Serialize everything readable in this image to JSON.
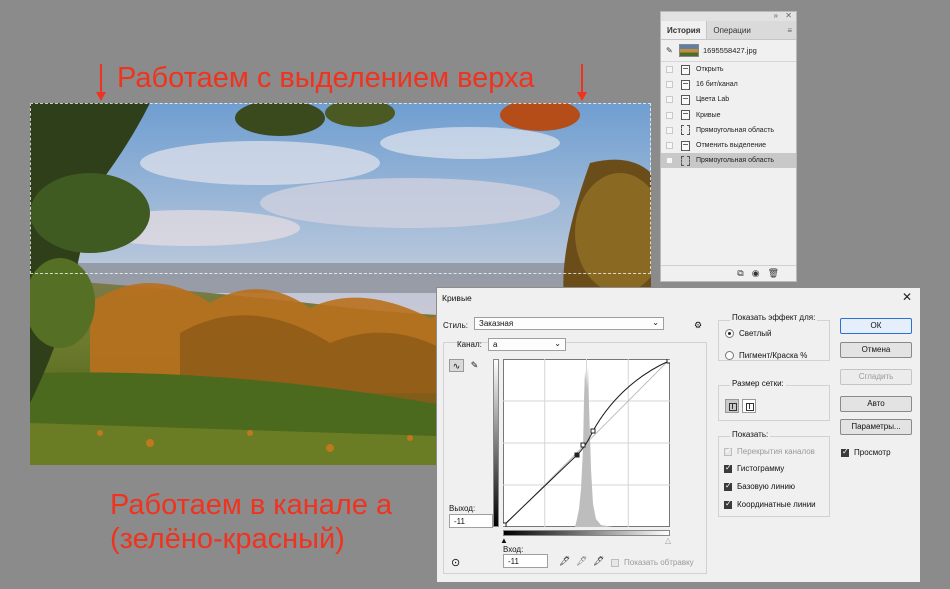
{
  "annotations": {
    "top": "Работаем с выделением верха",
    "bottom_line1": "Работаем в канале а",
    "bottom_line2": "(зелёно-красный)"
  },
  "history_panel": {
    "tabs": [
      "История",
      "Операции"
    ],
    "menu_icon": "menu-icon",
    "collapse_icon": "collapse-icon",
    "close_icon": "close-icon",
    "snapshot": "1695558427.jpg",
    "steps": [
      {
        "label": "Открыть",
        "icon": "document-icon"
      },
      {
        "label": "16 бит/канал",
        "icon": "document-icon"
      },
      {
        "label": "Цвета Lab",
        "icon": "document-icon"
      },
      {
        "label": "Кривые",
        "icon": "document-icon"
      },
      {
        "label": "Прямоугольная область",
        "icon": "marquee-icon"
      },
      {
        "label": "Отменить выделение",
        "icon": "document-icon"
      },
      {
        "label": "Прямоугольная область",
        "icon": "marquee-icon",
        "active": true
      }
    ],
    "footer_icons": [
      "new-document-from-state-icon",
      "camera-icon",
      "trash-icon"
    ]
  },
  "curves_dialog": {
    "title": "Кривые",
    "close": "✕",
    "style_label": "Стиль:",
    "style_value": "Заказная",
    "channel_label": "Канал:",
    "channel_value": "a",
    "output_label": "Выход:",
    "output_value": "-11",
    "input_label": "Вход:",
    "input_value": "-11",
    "show_clipping": "Показать обтравку",
    "show_effect_label": "Показать эффект для:",
    "radio_light": "Светлый",
    "radio_pigment": "Пигмент/Краска %",
    "grid_size_label": "Размер сетки:",
    "show_label": "Показать:",
    "checks": [
      {
        "label": "Перекрытия каналов",
        "checked": true,
        "disabled": true
      },
      {
        "label": "Гистограмму",
        "checked": true
      },
      {
        "label": "Базовую линию",
        "checked": true
      },
      {
        "label": "Координатные линии",
        "checked": true
      }
    ],
    "buttons": {
      "ok": "ОК",
      "cancel": "Отмена",
      "smooth": "Сгладить",
      "auto": "Авто",
      "params": "Параметры..."
    },
    "preview_label": "Просмотр",
    "accent_color": "#2f6fd0"
  },
  "colors": {
    "annotation": "#f0331f",
    "background": "#8b8b8b"
  }
}
